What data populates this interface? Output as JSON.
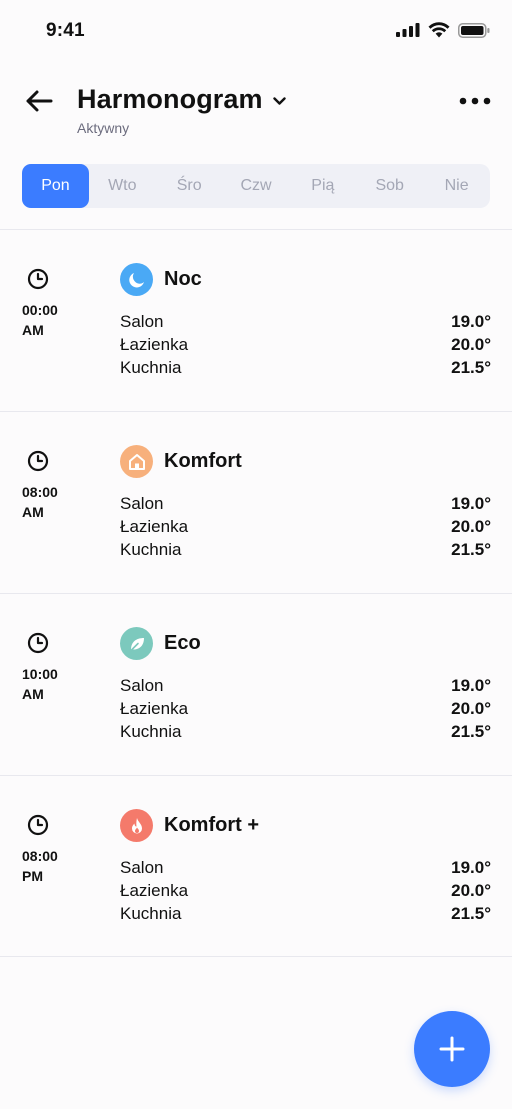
{
  "status_bar": {
    "time": "9:41"
  },
  "header": {
    "title": "Harmonogram",
    "subtitle": "Aktywny"
  },
  "days": [
    "Pon",
    "Wto",
    "Śro",
    "Czw",
    "Pią",
    "Sob",
    "Nie"
  ],
  "active_day": "Pon",
  "schedule": [
    {
      "time": "00:00\nAM",
      "mode": "Noc",
      "icon": "moon-icon",
      "color": "#4aa9f5",
      "rooms": [
        {
          "name": "Salon",
          "temp": "19.0°"
        },
        {
          "name": "Łazienka",
          "temp": "20.0°"
        },
        {
          "name": "Kuchnia",
          "temp": "21.5°"
        }
      ]
    },
    {
      "time": "08:00\nAM",
      "mode": "Komfort",
      "icon": "home-icon",
      "color": "#f7b07c",
      "rooms": [
        {
          "name": "Salon",
          "temp": "19.0°"
        },
        {
          "name": "Łazienka",
          "temp": "20.0°"
        },
        {
          "name": "Kuchnia",
          "temp": "21.5°"
        }
      ]
    },
    {
      "time": "10:00\nAM",
      "mode": "Eco",
      "icon": "leaf-icon",
      "color": "#7cc9bd",
      "rooms": [
        {
          "name": "Salon",
          "temp": "19.0°"
        },
        {
          "name": "Łazienka",
          "temp": "20.0°"
        },
        {
          "name": "Kuchnia",
          "temp": "21.5°"
        }
      ]
    },
    {
      "time": "08:00\nPM",
      "mode": "Komfort +",
      "icon": "flame-icon",
      "color": "#f47a6b",
      "rooms": [
        {
          "name": "Salon",
          "temp": "19.0°"
        },
        {
          "name": "Łazienka",
          "temp": "20.0°"
        },
        {
          "name": "Kuchnia",
          "temp": "21.5°"
        }
      ]
    }
  ],
  "colors": {
    "accent": "#3b7cff",
    "tab_bg": "#eff0f6",
    "tab_inactive_text": "#a4a7b5",
    "subtitle": "#6c6c7e"
  }
}
